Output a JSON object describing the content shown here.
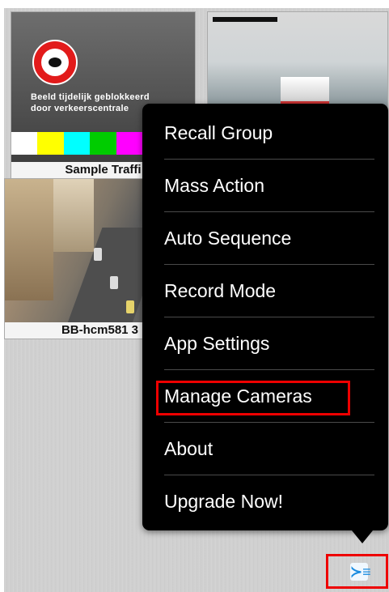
{
  "tiles": [
    {
      "caption": "Sample Traffi",
      "blocked_text_line1": "Beeld tijdelijk geblokkeerd",
      "blocked_text_line2": "door verkeerscentrale",
      "colorbars": [
        "#ffffff",
        "#ffff00",
        "#00ffff",
        "#00cc00",
        "#ff00ff",
        "#ff0000",
        "#0000ff"
      ]
    },
    {
      "caption": ""
    },
    {
      "caption": "BB-hcm581 3"
    }
  ],
  "menu": {
    "items": [
      {
        "label": "Recall Group"
      },
      {
        "label": "Mass Action"
      },
      {
        "label": "Auto Sequence"
      },
      {
        "label": "Record Mode"
      },
      {
        "label": "App Settings"
      },
      {
        "label": "Manage Cameras"
      },
      {
        "label": "About"
      },
      {
        "label": "Upgrade Now!"
      }
    ]
  },
  "toolbar": {
    "menu_icon": "menu-list-icon",
    "menu_glyph": "≻≡"
  },
  "colors": {
    "highlight": "#ee0000",
    "menu_bg": "#000000",
    "icon_blue": "#1a8ce0"
  }
}
